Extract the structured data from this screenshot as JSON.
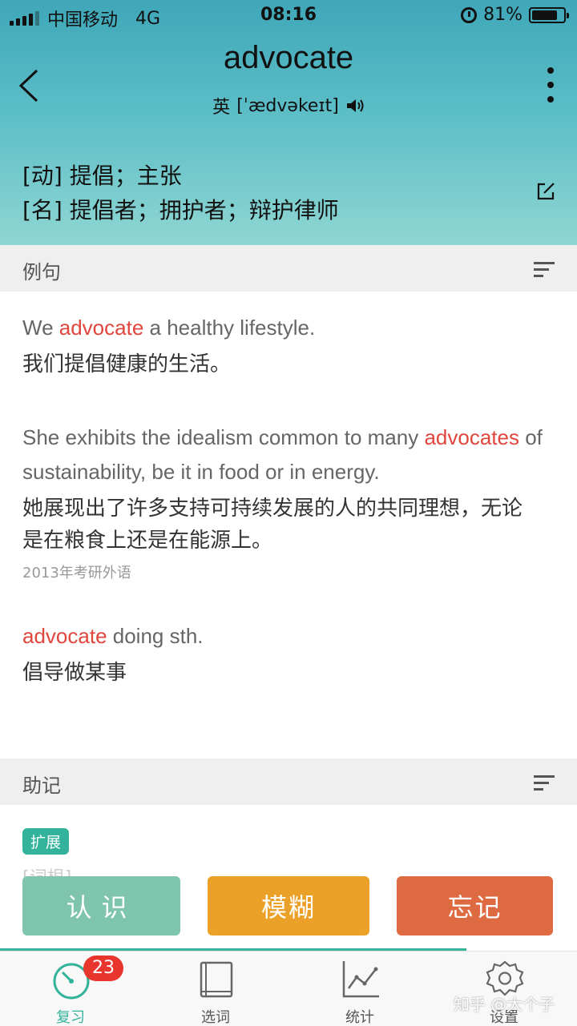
{
  "status_bar": {
    "carrier": "中国移动",
    "network": "4G",
    "time": "08:16",
    "battery": "81%",
    "battery_level": 0.81
  },
  "header": {
    "word": "advocate",
    "phonetic_region": "英",
    "phonetic": "[ˈædvəkeɪt]",
    "definitions": [
      "[动] 提倡；主张",
      "[名] 提倡者；拥护者；辩护律师"
    ],
    "icons": {
      "back": "back-chevron-icon",
      "more": "more-vertical-icon",
      "speaker": "speaker-icon",
      "edit": "edit-icon"
    }
  },
  "examples_section": {
    "title": "例句",
    "items": [
      {
        "en_before": "We ",
        "en_highlight": "advocate",
        "en_after": " a healthy lifestyle.",
        "zh": "我们提倡健康的生活。",
        "source": ""
      },
      {
        "en_before": "She exhibits the idealism common to many ",
        "en_highlight": "advocates",
        "en_after": " of sustainability, be it in food or in energy.",
        "zh": "她展现出了许多支持可持续发展的人的共同理想，无论是在粮食上还是在能源上。",
        "source": "2013年考研外语"
      },
      {
        "en_before": "",
        "en_highlight": "advocate",
        "en_after": " doing sth.",
        "zh": "倡导做某事",
        "source": ""
      }
    ]
  },
  "mnemonic_section": {
    "title": "助记",
    "tag": "扩展",
    "faded_text": "[词根]"
  },
  "actions": {
    "know": "认识",
    "fuzzy": "模糊",
    "forget": "忘记"
  },
  "tabbar": {
    "badge": "23",
    "tabs": [
      {
        "label": "复习",
        "icon": "review-clock-icon",
        "active": true
      },
      {
        "label": "选词",
        "icon": "book-icon",
        "active": false
      },
      {
        "label": "统计",
        "icon": "stats-chart-icon",
        "active": false
      },
      {
        "label": "设置",
        "icon": "gear-icon",
        "active": false
      }
    ],
    "watermark": "知乎 @大个子"
  },
  "colors": {
    "highlight": "#e0463d",
    "accent": "#33b39b",
    "know": "#7fc5ad",
    "fuzzy": "#eba127",
    "forget": "#de6a42",
    "badge": "#e8352d"
  }
}
